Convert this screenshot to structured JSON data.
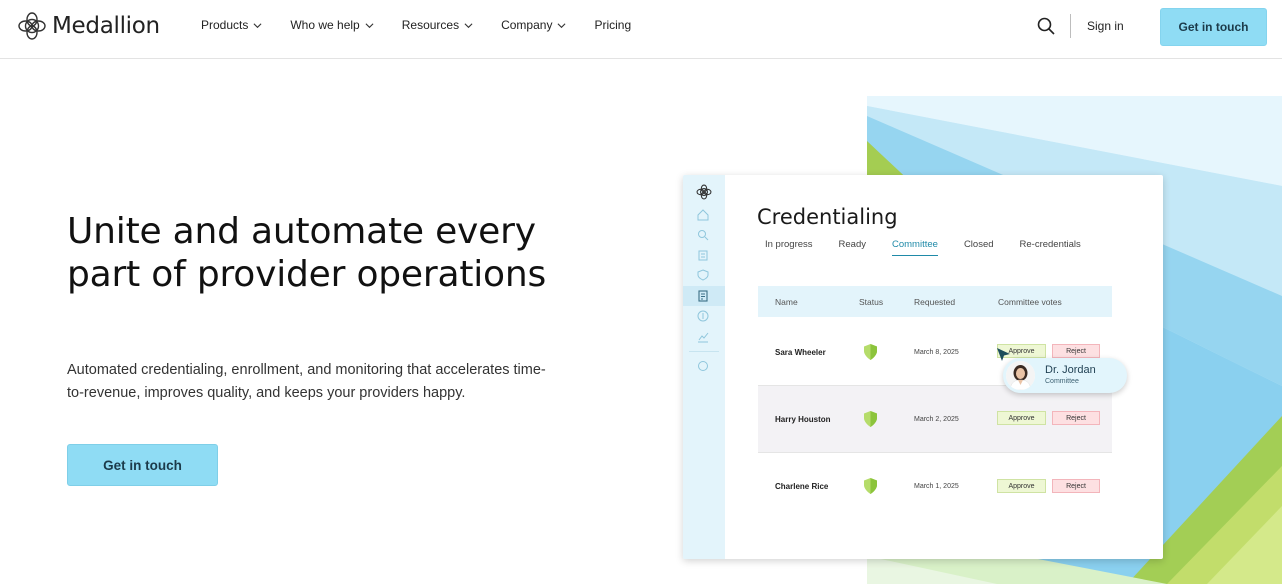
{
  "nav": {
    "brand": "Medallion",
    "links": [
      {
        "label": "Products",
        "has_dropdown": true
      },
      {
        "label": "Who we help",
        "has_dropdown": true
      },
      {
        "label": "Resources",
        "has_dropdown": true
      },
      {
        "label": "Company",
        "has_dropdown": true
      },
      {
        "label": "Pricing",
        "has_dropdown": false
      }
    ],
    "signin": "Sign in",
    "cta": "Get in touch"
  },
  "hero": {
    "title": "Unite and automate every part of provider operations",
    "subtitle": "Automated credentialing, enrollment, and monitoring that accelerates time-to-revenue, improves quality, and keeps your providers happy.",
    "cta": "Get in touch"
  },
  "mockup": {
    "title": "Credentialing",
    "tabs": [
      "In progress",
      "Ready",
      "Committee",
      "Closed",
      "Re-credentials"
    ],
    "active_tab": "Committee",
    "columns": [
      "Name",
      "Status",
      "Requested",
      "Committee votes"
    ],
    "rows": [
      {
        "name": "Sara Wheeler",
        "requested": "March 8, 2025",
        "approve": "Approve",
        "reject": "Reject"
      },
      {
        "name": "Harry Houston",
        "requested": "March 2, 2025",
        "approve": "Approve",
        "reject": "Reject"
      },
      {
        "name": "Charlene Rice",
        "requested": "March 1, 2025",
        "approve": "Approve",
        "reject": "Reject"
      }
    ],
    "vote_card": {
      "name": "Dr. Jordan",
      "role": "Committee"
    }
  },
  "colors": {
    "accent": "#8fdcf4",
    "active_tab": "#1f8aa8",
    "approve_bg": "#eef7d4",
    "reject_bg": "#fde0e2",
    "sidebar": "#e3f4fb"
  }
}
